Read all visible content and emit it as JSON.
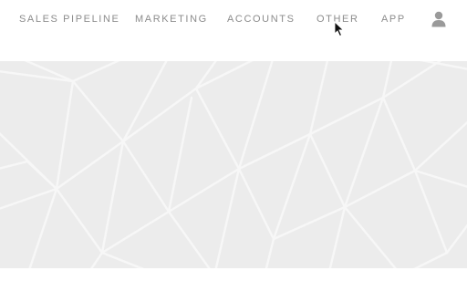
{
  "nav": {
    "items": [
      {
        "label": "SALES PIPELINE"
      },
      {
        "label": "MARKETING"
      },
      {
        "label": "ACCOUNTS"
      },
      {
        "label": "OTHER"
      },
      {
        "label": "APP"
      }
    ],
    "user_icon": "user-icon"
  },
  "colors": {
    "nav_text": "#8c8c8c",
    "hero_background": "#ececec",
    "hero_lines": "#f8f8f8",
    "icon": "#9a9a9a"
  }
}
